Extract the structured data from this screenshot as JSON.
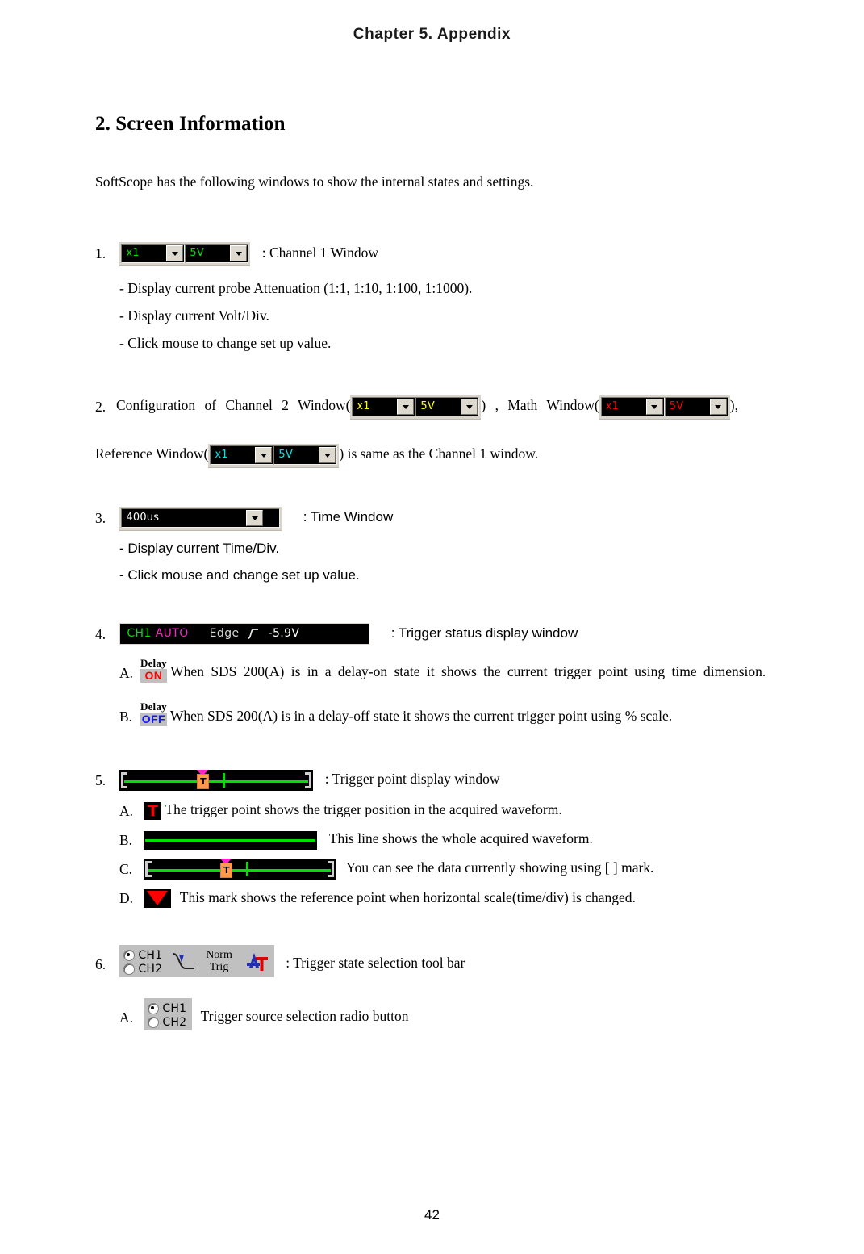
{
  "header": {
    "chapter": "Chapter 5. Appendix"
  },
  "footer": {
    "page_number": "42"
  },
  "section": {
    "title": "2. Screen Information",
    "intro": "SoftScope has the following windows to show the internal states and settings."
  },
  "items": {
    "one": {
      "number": "1.",
      "caption": ": Channel 1 Window",
      "widget": {
        "attenuation": "x1",
        "voltdiv": "5V",
        "text_color": "#00e000"
      },
      "bullets": [
        "- Display current probe Attenuation (1:1, 1:10, 1:100, 1:1000).",
        "- Display current Volt/Div.",
        "- Click mouse to change set up value."
      ]
    },
    "two": {
      "number": "2.",
      "text_a": "Configuration of Channel 2 Window(",
      "text_b": ") , Math Window(",
      "text_c": "),",
      "text_d": "Reference Window(",
      "text_e": ") is same as the Channel 1 window.",
      "ch2_widget": {
        "attenuation": "x1",
        "voltdiv": "5V",
        "text_color": "#ffff00"
      },
      "math_widget": {
        "attenuation": "x1",
        "voltdiv": "5V",
        "text_color": "#ff0000"
      },
      "ref_widget": {
        "attenuation": "x1",
        "voltdiv": "5V",
        "text_color": "#00e8e8"
      }
    },
    "three": {
      "number": "3.",
      "caption": ": Time Window",
      "widget": {
        "timediv": "400us",
        "text_color": "#ffffff"
      },
      "bullets": [
        "- Display current Time/Div.",
        "- Click mouse and change set up value."
      ]
    },
    "four": {
      "number": "4.",
      "caption": ": Trigger status display window",
      "status": {
        "source": "CH1",
        "source_color": "#00e000",
        "mode": "AUTO",
        "mode_color": "#ff22c8",
        "type": "Edge",
        "type_color": "#d8d8d8",
        "slope_icon": "rising-edge-slope-icon",
        "level": "-5.9V",
        "level_color": "#ffffff"
      },
      "sub": [
        {
          "letter": "A.",
          "badge_caption": "Delay",
          "badge_state": "ON",
          "badge_state_color": "#ff0000",
          "text": "When SDS 200(A) is in a delay-on state it shows the current trigger point using time dimension."
        },
        {
          "letter": "B.",
          "badge_caption": "Delay",
          "badge_state": "OFF",
          "badge_state_color": "#1414ff",
          "text": "When SDS 200(A) is in a delay-off state it shows the current trigger point using % scale."
        }
      ]
    },
    "five": {
      "number": "5.",
      "caption": ": Trigger point display window",
      "marker_label": "T",
      "sub": [
        {
          "letter": "A.",
          "icon": "red-trigger-point-icon",
          "text": "The trigger point shows the trigger position in the acquired waveform."
        },
        {
          "letter": "B.",
          "icon": "green-waveform-line-bar",
          "text": "This line shows the whole acquired waveform."
        },
        {
          "letter": "C.",
          "icon": "trigger-point-bar-with-brackets",
          "text": "You can see the data currently showing using [ ] mark."
        },
        {
          "letter": "D.",
          "icon": "red-reference-triangle-icon",
          "text": "This mark shows the reference point when horizontal scale(time/div) is changed."
        }
      ]
    },
    "six": {
      "number": "6.",
      "caption": ": Trigger state selection tool bar",
      "toolbar": {
        "radio_ch1": "CH1",
        "radio_ch2": "CH2",
        "radio_selected": "CH1",
        "slope_icon": "falling-edge-slope-icon",
        "norm_line1": "Norm",
        "norm_line2": "Trig",
        "auto_trig_icon_a": "A",
        "auto_trig_icon_t": "T",
        "auto_trig_a_color": "#2030b0",
        "auto_trig_t_color": "#e00000"
      },
      "sub": [
        {
          "letter": "A.",
          "radio_ch1": "CH1",
          "radio_ch2": "CH2",
          "text": "Trigger source selection radio button"
        }
      ]
    }
  }
}
